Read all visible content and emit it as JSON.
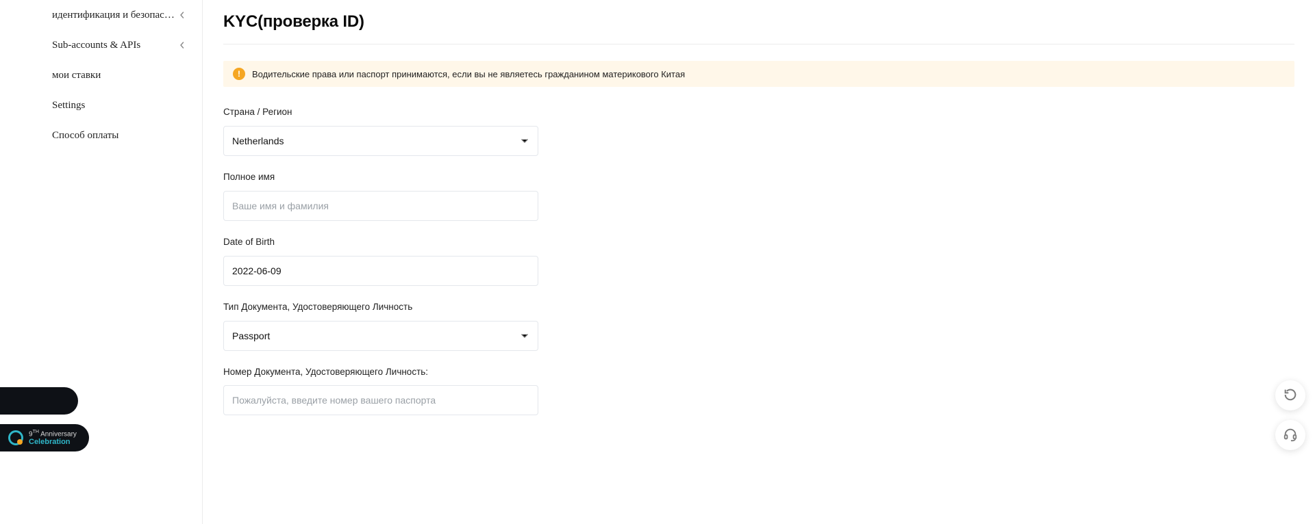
{
  "sidebar": {
    "items": [
      {
        "label": "идентификация и безопасно…",
        "has_chevron": true
      },
      {
        "label": "Sub-accounts & APIs",
        "has_chevron": true
      },
      {
        "label": "мои ставки",
        "has_chevron": false
      },
      {
        "label": "Settings",
        "has_chevron": false
      },
      {
        "label": "Способ оплаты",
        "has_chevron": false
      }
    ]
  },
  "page": {
    "title": "KYC(проверка ID)"
  },
  "notice": {
    "text": "Водительские права или паспорт принимаются, если вы не являетесь гражданином материкового Китая"
  },
  "form": {
    "country": {
      "label": "Страна / Регион",
      "value": "Netherlands"
    },
    "full_name": {
      "label": "Полное имя",
      "placeholder": "Ваше имя и фамилия",
      "value": ""
    },
    "dob": {
      "label": "Date of Birth",
      "value": "2022-06-09"
    },
    "doc_type": {
      "label": "Тип Документа, Удостоверяющего Личность",
      "value": "Passport"
    },
    "doc_number": {
      "label": "Номер Документа, Удостоверяющего Личность:",
      "placeholder": "Пожалуйста, введите номер вашего паспорта",
      "value": ""
    }
  },
  "promo": {
    "line1_prefix": "9",
    "line1_sup": "TH",
    "line1_suffix": " Anniversary",
    "line2": "Celebration"
  }
}
